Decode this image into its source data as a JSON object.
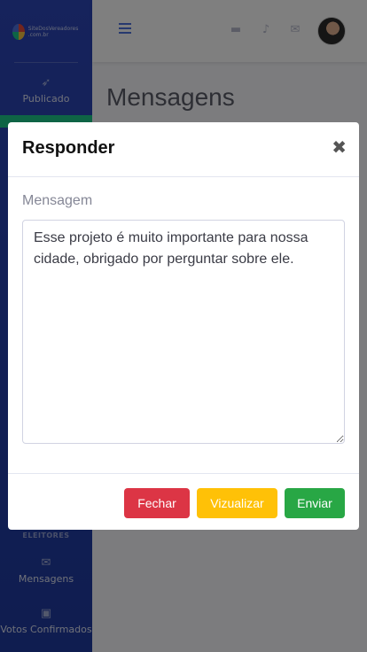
{
  "sidebar": {
    "brand_text": "SiteDosVereadores .com.br",
    "items": [
      {
        "label": "Publicado",
        "icon": "rocket-icon"
      },
      {
        "label": "Mensagens",
        "icon": "envelope-icon"
      },
      {
        "label": "Votos Confirmados",
        "icon": "vote-box-icon"
      }
    ],
    "section_heading": "ELEITORES"
  },
  "topbar": {
    "icons": [
      "menu-icon",
      "inbox-icon",
      "bell-icon",
      "envelope-icon",
      "avatar"
    ]
  },
  "page": {
    "title": "Mensagens"
  },
  "modal": {
    "title": "Responder",
    "close_glyph": "✖",
    "field_label": "Mensagem",
    "message_value": "Esse projeto é muito importante para nossa cidade, obrigado por perguntar sobre ele.",
    "buttons": {
      "close": "Fechar",
      "preview": "Vizualizar",
      "send": "Enviar"
    }
  },
  "colors": {
    "sidebar": "#2c46b8",
    "primary": "#4e73df",
    "danger": "#dc3545",
    "warning": "#ffc107",
    "success": "#28a745"
  }
}
